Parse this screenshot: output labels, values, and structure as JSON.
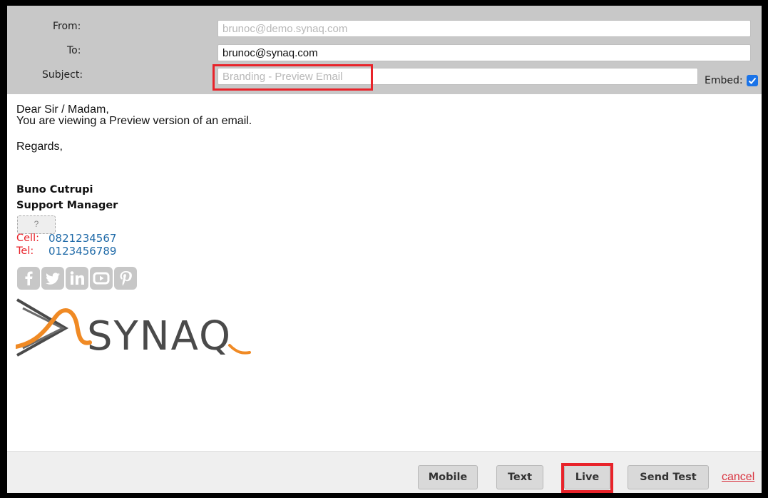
{
  "header": {
    "from_label": "From:",
    "from_value": "brunoc@demo.synaq.com",
    "to_label": "To:",
    "to_value": "brunoc@synaq.com",
    "subject_label": "Subject:",
    "subject_placeholder": "Branding - Preview Email",
    "embed_label": "Embed:",
    "embed_checked": true
  },
  "message": {
    "greeting": "Dear Sir / Madam,",
    "line1": "You are viewing a Preview version of an email.",
    "closing": "Regards,",
    "signature": {
      "name": "Buno Cutrupi",
      "title": "Support Manager",
      "image_placeholder": "?",
      "cell_label": "Cell:",
      "cell_value": "0821234567",
      "tel_label": "Tel:",
      "tel_value": "0123456789",
      "social_icons": [
        "facebook-icon",
        "twitter-icon",
        "linkedin-icon",
        "youtube-icon",
        "pinterest-icon"
      ],
      "logo_text": "SYNAQ"
    }
  },
  "footer": {
    "mobile_label": "Mobile",
    "text_label": "Text",
    "live_label": "Live",
    "send_test_label": "Send Test",
    "cancel_label": "cancel"
  },
  "colors": {
    "highlight": "#e8232a",
    "link": "#1f6aa8",
    "checkbox": "#1a73e8",
    "logo_orange": "#f08a24",
    "logo_gray": "#4a4a4a"
  }
}
